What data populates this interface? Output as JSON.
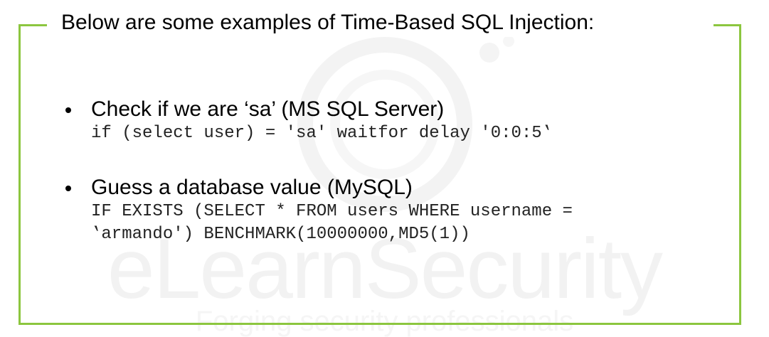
{
  "heading": "Below are some examples of Time-Based SQL Injection:",
  "items": [
    {
      "label": "Check if we are ‘sa’ (MS SQL Server)",
      "code": [
        "if (select user) = 'sa' waitfor delay '0:0:5‛"
      ]
    },
    {
      "label": "Guess a database value (MySQL)",
      "code": [
        "IF EXISTS (SELECT * FROM users WHERE username =",
        "‛armando') BENCHMARK(10000000,MD5(1))"
      ]
    }
  ],
  "watermark": {
    "brand": "eLearnSecurity",
    "tagline": "Forging security professionals"
  },
  "colors": {
    "frame": "#8cc63f",
    "watermark": "#f2f2f2"
  }
}
